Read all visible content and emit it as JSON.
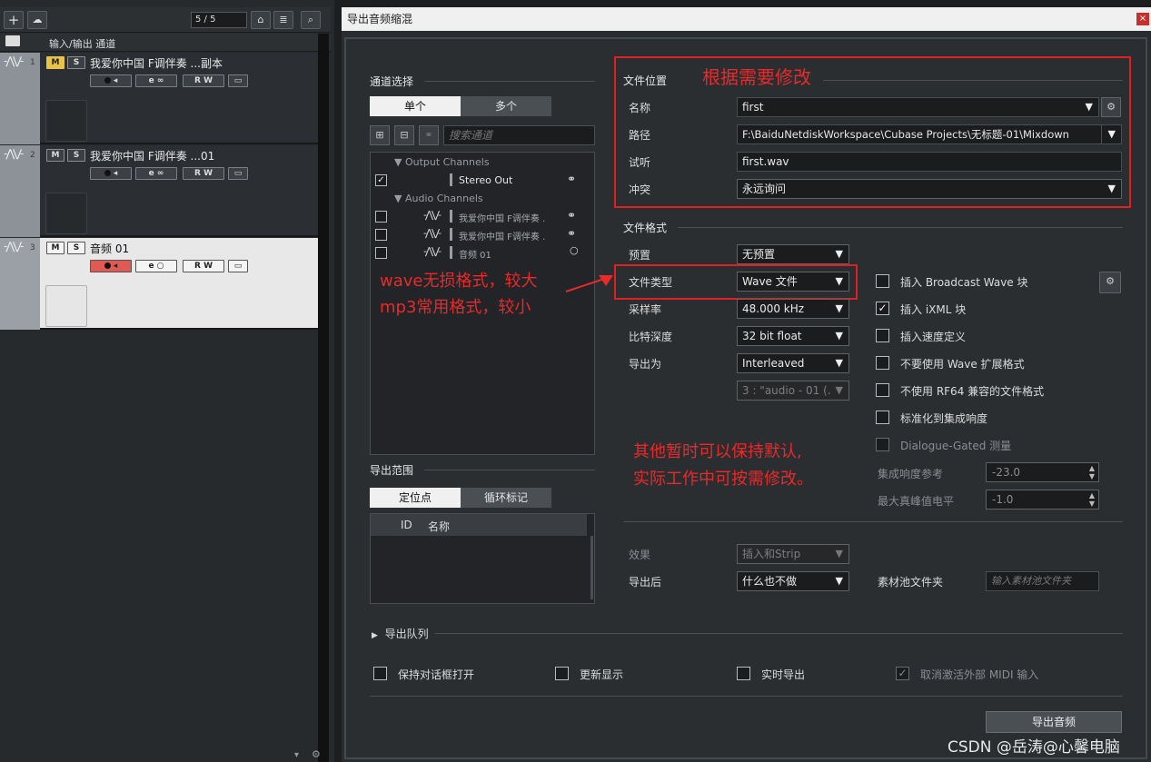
{
  "left": {
    "counter": "5 / 5",
    "header": "输入/输出 通道",
    "tracks": [
      {
        "num": "1",
        "name": "我爱你中国 F调伴奏 ...副本"
      },
      {
        "num": "2",
        "name": "我爱你中国 F调伴奏 ...01"
      },
      {
        "num": "3",
        "name": "音频 01"
      }
    ],
    "m": "M",
    "s": "S",
    "e": "e",
    "r": "R",
    "w": "W"
  },
  "dialog": {
    "title": "导出音频缩混",
    "channel_select": {
      "title": "通道选择",
      "tab_single": "单个",
      "tab_multi": "多个",
      "search_placeholder": "搜索通道",
      "output_group": "Output Channels",
      "stereo_out": "Stereo Out",
      "audio_group": "Audio Channels",
      "items": [
        "我爱你中国 F调伴奏 .",
        "我爱你中国 F调伴奏 .",
        "音频 01"
      ]
    },
    "export_range": {
      "title": "导出范围",
      "tab_locators": "定位点",
      "tab_cycle": "循环标记",
      "col_id": "ID",
      "col_name": "名称"
    },
    "file_location": {
      "title": "文件位置",
      "name_label": "名称",
      "name_value": "first",
      "path_label": "路径",
      "path_value": "F:\\BaiduNetdiskWorkspace\\Cubase Projects\\无标题-01\\Mixdown",
      "preview_label": "试听",
      "preview_value": "first.wav",
      "conflict_label": "冲突",
      "conflict_value": "永远询问"
    },
    "file_format": {
      "title": "文件格式",
      "preset_label": "预置",
      "preset_value": "无预置",
      "type_label": "文件类型",
      "type_value": "Wave 文件",
      "rate_label": "采样率",
      "rate_value": "48.000 kHz",
      "depth_label": "比特深度",
      "depth_value": "32 bit float",
      "export_as_label": "导出为",
      "export_as_value": "Interleaved",
      "channel_value": "3 : \"audio - 01 (."
    },
    "options": {
      "bwf": "插入 Broadcast Wave 块",
      "ixml": "插入 iXML 块",
      "tempo": "插入速度定义",
      "no_wave_ext": "不要使用 Wave 扩展格式",
      "no_rf64": "不使用 RF64 兼容的文件格式",
      "normalize": "标准化到集成响度",
      "dialogue": "Dialogue-Gated 测量",
      "loudness_ref_label": "集成响度参考",
      "loudness_ref_value": "-23.0",
      "true_peak_label": "最大真峰值电平",
      "true_peak_value": "-1.0"
    },
    "effects_label": "效果",
    "effects_value": "插入和Strip",
    "after_label": "导出后",
    "after_value": "什么也不做",
    "pool_label": "素材池文件夹",
    "pool_placeholder": "输入素材池文件夹",
    "queue_label": "导出队列",
    "bottom": {
      "keep_open": "保持对话框打开",
      "update_display": "更新显示",
      "realtime": "实时导出",
      "deactivate_midi": "取消激活外部 MIDI 输入"
    },
    "export_button": "导出音频"
  },
  "annotations": {
    "a1": "根据需要修改",
    "a2_line1": "wave无损格式，较大",
    "a2_line2": "mp3常用格式，较小",
    "a3_line1": "其他暂时可以保持默认,",
    "a3_line2": "实际工作中可按需修改。"
  },
  "watermark": "CSDN @岳涛@心馨电脑"
}
